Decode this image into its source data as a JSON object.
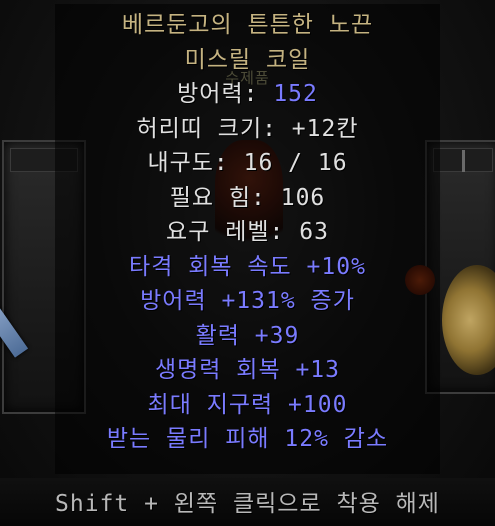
{
  "item": {
    "name": "베르둔고의 튼튼한 노끈",
    "base_type": "미스릴 코일",
    "ghost_label": "수제품",
    "stats": [
      {
        "text": "방어력: ",
        "value": "152",
        "value_color": "blue"
      },
      {
        "text": "허리띠 크기: +12칸"
      },
      {
        "text": "내구도: 16 / 16"
      },
      {
        "text": "필요 힘: 106"
      },
      {
        "text": "요구 레벨: 63"
      }
    ],
    "magic_properties": [
      "타격 회복 속도 +10%",
      "방어력 +131% 증가",
      "활력 +39",
      "생명력 회복 +13",
      "최대 지구력 +100",
      "받는 물리 피해 12% 감소"
    ]
  },
  "footer": {
    "hint": "Shift + 왼쪽 클릭으로 착용 해제"
  },
  "colors": {
    "unique_name": "#c5b381",
    "base_stat": "#e0e0e0",
    "magic": "#7a7bff"
  }
}
